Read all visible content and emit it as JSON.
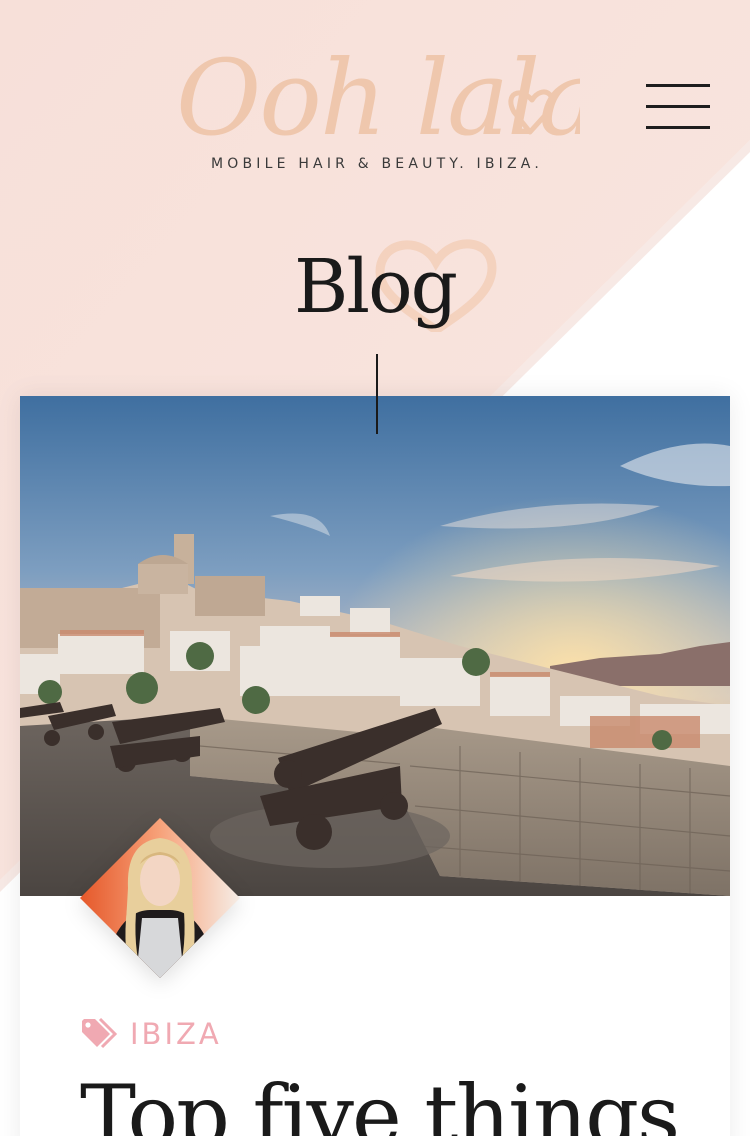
{
  "header": {
    "logo_text": "Ooh lala",
    "tagline": "MOBILE HAIR & BEAUTY. IBIZA.",
    "menu_icon": "hamburger-menu-icon"
  },
  "page": {
    "title": "Blog"
  },
  "post": {
    "image_subject": "ibiza-old-town-cannons-sunset",
    "category": "IBIZA",
    "category_icon": "tag-icon",
    "title": "Top five things"
  },
  "colors": {
    "accent_pink": "#f0a9b2",
    "logo_peach": "#efc7ad",
    "background_pink": "#f8e3dd",
    "text_dark": "#1a1a1a"
  }
}
